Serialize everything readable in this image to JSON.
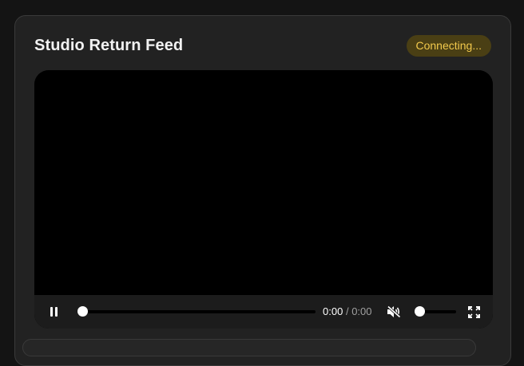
{
  "card": {
    "title": "Studio Return Feed",
    "status": "Connecting...",
    "status_color": "#f2c94c",
    "status_bg": "#4a3f14"
  },
  "player": {
    "current_time": "0:00",
    "separator": "/",
    "duration": "0:00",
    "progress_fraction": 0,
    "volume_fraction": 0,
    "muted": true,
    "state": "playing",
    "icons": {
      "play_pause": "pause-icon",
      "mute": "volume-muted-icon",
      "fullscreen": "fullscreen-icon"
    }
  }
}
